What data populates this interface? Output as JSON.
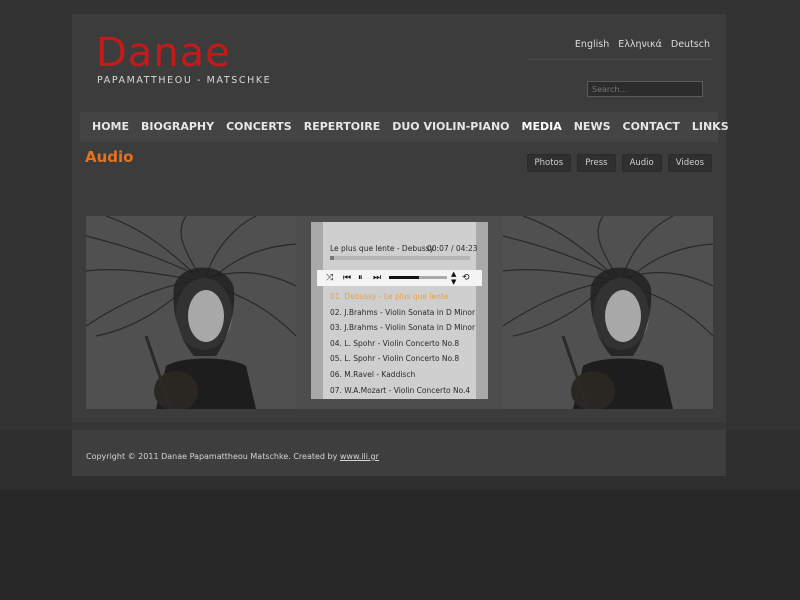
{
  "brand": {
    "name": "Danae",
    "subtitle": "PAPAMATTHEOU - MATSCHKE",
    "color": "#c41a1a"
  },
  "languages": [
    "English",
    "Ελληνικά",
    "Deutsch"
  ],
  "search": {
    "placeholder": "Search..."
  },
  "nav": [
    "HOME",
    "BIOGRAPHY",
    "CONCERTS",
    "REPERTOIRE",
    "DUO VIOLIN-PIANO",
    "MEDIA",
    "NEWS",
    "CONTACT",
    "LINKS"
  ],
  "nav_active": "MEDIA",
  "page": {
    "title": "Audio",
    "accent": "#e8721c"
  },
  "tabs": [
    "Photos",
    "Press",
    "Audio",
    "Videos"
  ],
  "player": {
    "now_playing": "Le plus que lente - Debussy",
    "time": "00:07 / 04:23",
    "progress": 0.03,
    "volume": 0.52,
    "tracks": [
      "01. Debussy - Le plus que lente",
      "02. J.Brahms - Violin Sonata in D Minor",
      "03. J.Brahms - Violin Sonata in D Minor",
      "04. L. Spohr - Violin Concerto No.8",
      "05. L. Spohr - Violin Concerto No.8",
      "06. M.Ravel - Kaddisch",
      "07. W.A.Mozart - Violin Concerto No.4"
    ],
    "active_index": 0,
    "icons": [
      "shuffle-icon",
      "previous-icon",
      "pause-icon",
      "next-icon",
      "volume-stepper-icon",
      "repeat-icon"
    ]
  },
  "footer": {
    "text": "Copyright © 2011 Danae Papamattheou Matschke. Created by",
    "link": "www.ili.gr"
  }
}
